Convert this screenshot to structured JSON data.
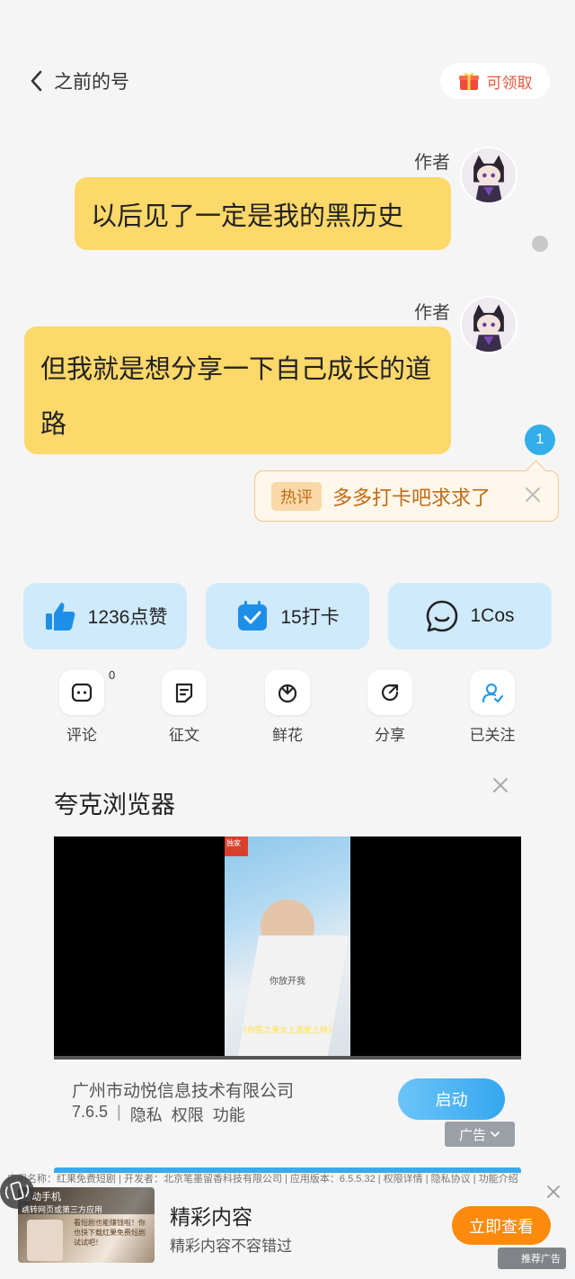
{
  "header": {
    "back_label": "之前的号",
    "claim_label": "可领取"
  },
  "messages": [
    {
      "author": "作者",
      "text": "以后见了一定是我的黑历史"
    },
    {
      "author": "作者",
      "text": "但我就是想分享一下自己成长的道路"
    }
  ],
  "reply_count": "1",
  "hot_comment": {
    "tag": "热评",
    "text": "多多打卡吧求求了"
  },
  "stats": [
    {
      "label": "1236点赞",
      "icon": "thumbs-up-icon"
    },
    {
      "label": "15打卡",
      "icon": "calendar-check-icon"
    },
    {
      "label": "1Cos",
      "icon": "chat-bubble-icon"
    }
  ],
  "actions": [
    {
      "label": "评论",
      "icon": "comment-icon"
    },
    {
      "label": "征文",
      "icon": "essay-icon"
    },
    {
      "label": "鲜花",
      "icon": "flower-icon"
    },
    {
      "label": "分享",
      "icon": "share-icon"
    },
    {
      "label": "已关注",
      "icon": "followed-user-icon"
    }
  ],
  "comment_count": "0",
  "ad": {
    "title": "夸克浏览器",
    "video_caption": "你放开我",
    "video_sub": "《你惹之美女上源更上映》",
    "company": "广州市动悦信息技术有限公司",
    "version": "7.6.5",
    "links": [
      "隐私",
      "权限",
      "功能"
    ],
    "launch_label": "启动",
    "ad_tag": "广告"
  },
  "bottom_ad": {
    "disclaimer": "应用名称：红果免费短剧 | 开发者：北京笔墨留香科技有限公司 | 应用版本：6.5.5.32 | 权限详情 | 隐私协议 | 功能介绍",
    "thumb_title": "摇动手机",
    "thumb_sub": "跳转网页或第三方应用",
    "thumb_text": "看短剧也能赚钱啦！你也快下载红果免费短剧试试吧！",
    "title": "精彩内容",
    "subtitle": "精彩内容不容错过",
    "cta_label": "立即查看",
    "rec_label": "推荐广告"
  },
  "colors": {
    "bubble": "#fdd86a",
    "stat_card": "#cfeafc",
    "accent_blue": "#34aee8",
    "accent_orange": "#fb8a0d"
  }
}
